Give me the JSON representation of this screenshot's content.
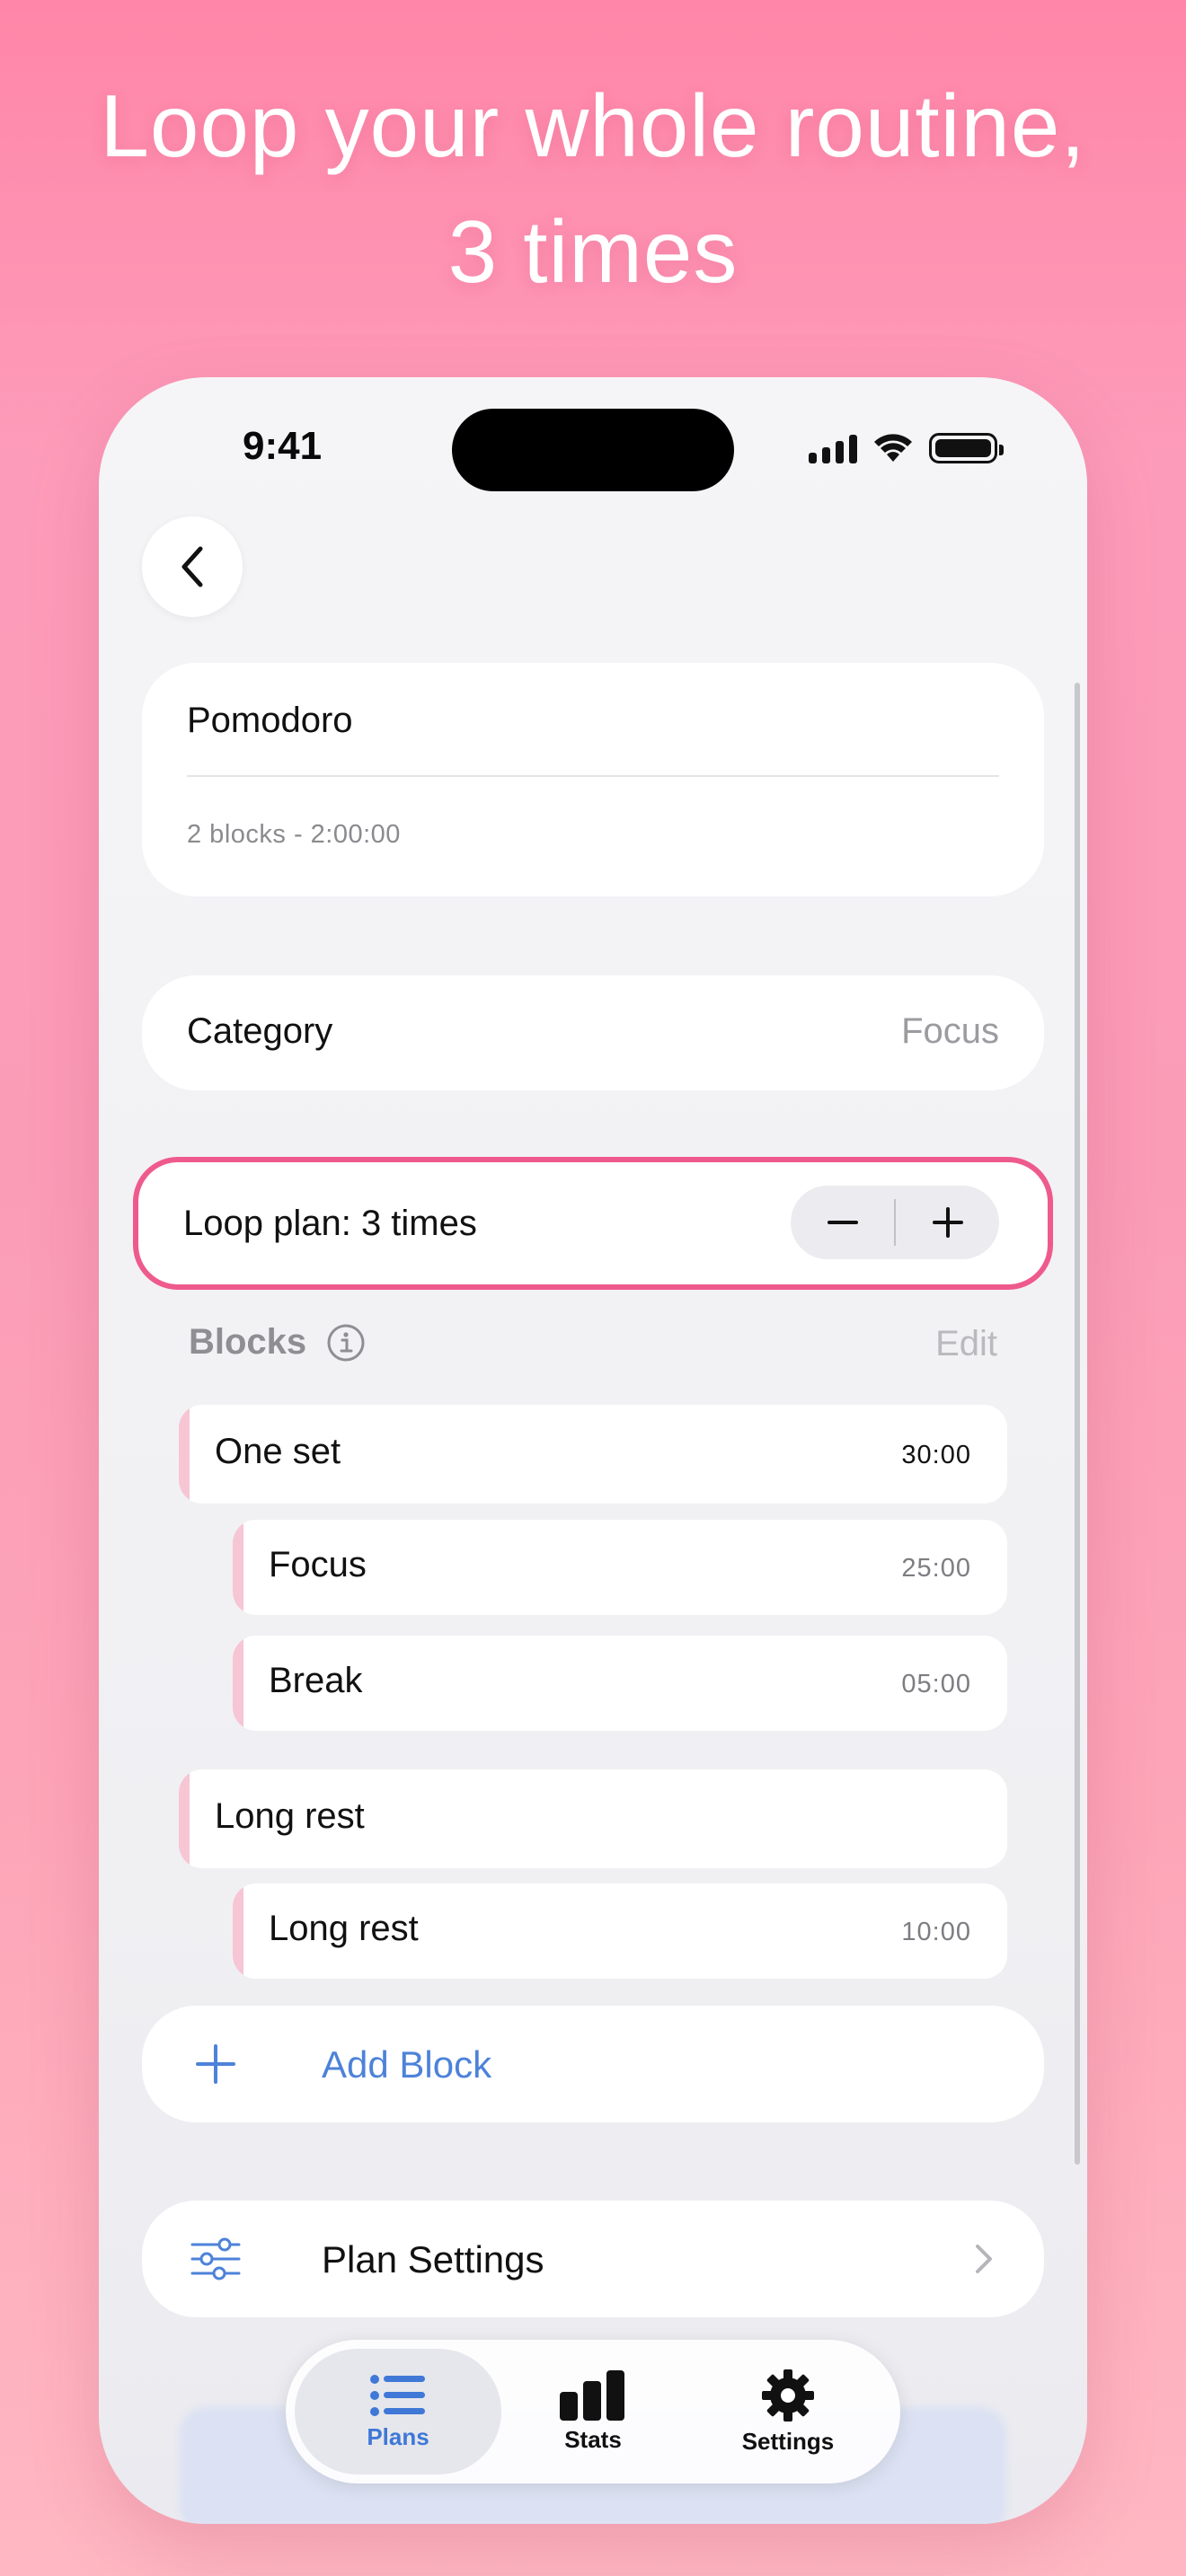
{
  "headline": {
    "line1": "Loop your whole routine,",
    "line2": "3 times"
  },
  "status_bar": {
    "time": "9:41"
  },
  "plan": {
    "title": "Pomodoro",
    "summary": "2 blocks - 2:00:00"
  },
  "category": {
    "label": "Category",
    "value": "Focus"
  },
  "loop": {
    "label": "Loop plan: 3 times"
  },
  "blocks": {
    "title": "Blocks",
    "edit_label": "Edit",
    "groups": [
      {
        "name": "One set",
        "duration": "30:00",
        "children": [
          {
            "name": "Focus",
            "duration": "25:00"
          },
          {
            "name": "Break",
            "duration": "05:00"
          }
        ]
      },
      {
        "name": "Long rest",
        "duration": "",
        "children": [
          {
            "name": "Long rest",
            "duration": "10:00"
          }
        ]
      }
    ]
  },
  "add_block": {
    "label": "Add Block"
  },
  "plan_settings": {
    "label": "Plan Settings"
  },
  "tabbar": {
    "tabs": [
      {
        "label": "Plans",
        "icon": "list-icon",
        "active": true
      },
      {
        "label": "Stats",
        "icon": "bar-chart-icon",
        "active": false
      },
      {
        "label": "Settings",
        "icon": "gear-icon",
        "active": false
      }
    ]
  },
  "colors": {
    "accent_pink": "#ef5a8c",
    "link_blue": "#4d82d9",
    "block_accent": "#f6c6d4"
  }
}
